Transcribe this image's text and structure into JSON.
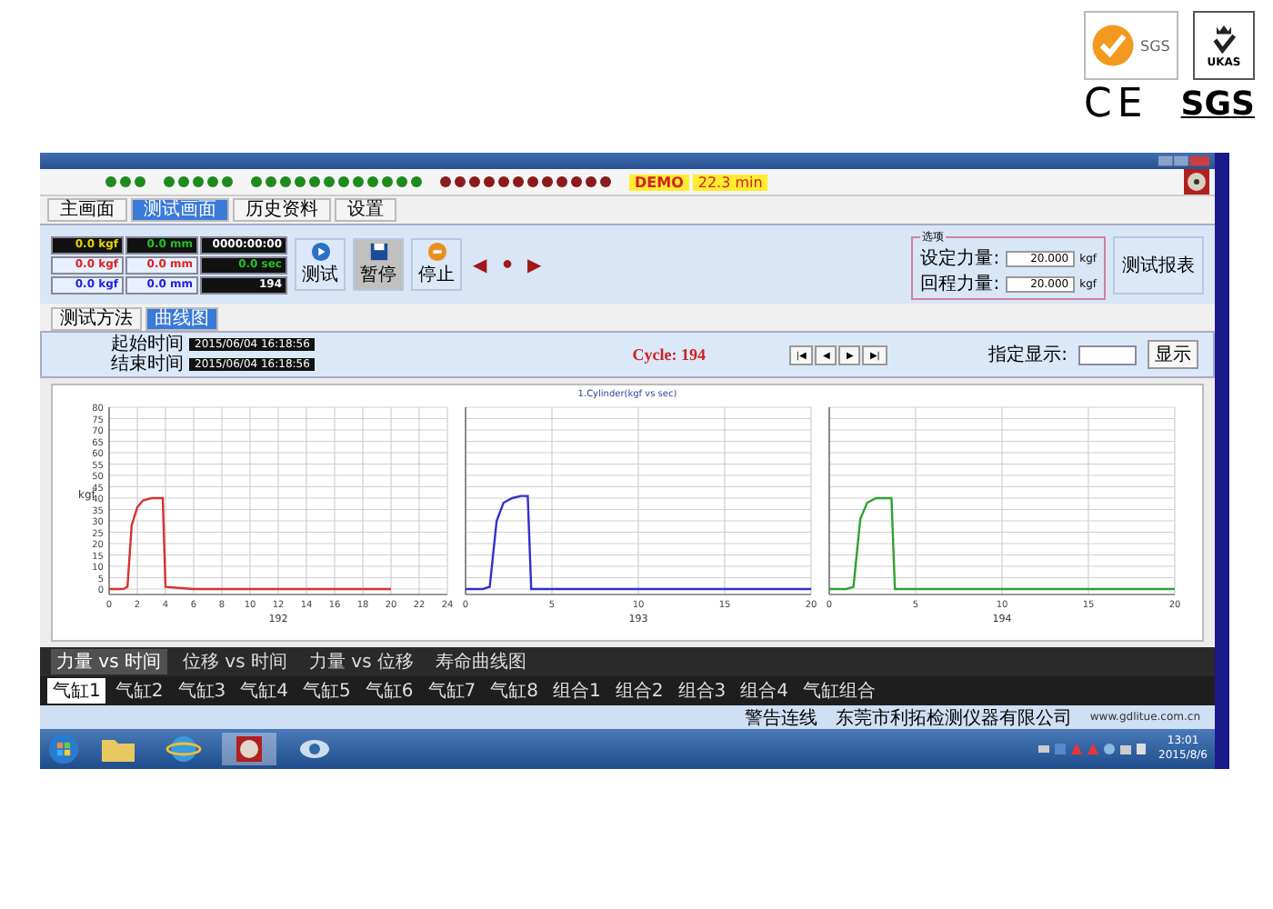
{
  "logos": {
    "badge_text": "SGS",
    "ukas_text": "UKAS",
    "ce_text": "CE",
    "sgs_text": "SGS"
  },
  "led_groups": [
    {
      "color": "#1e8a1e",
      "leds": [
        {
          "lit": true
        },
        {
          "lit": true
        },
        {
          "lit": true
        }
      ]
    },
    {
      "color": "#1e8a1e",
      "leds": [
        {
          "lit": true
        },
        {
          "lit": true
        },
        {
          "lit": true
        },
        {
          "lit": true
        },
        {
          "lit": true
        }
      ]
    },
    {
      "color": "#1e8a1e",
      "leds": [
        {
          "lit": true
        },
        {
          "lit": true
        },
        {
          "lit": true
        },
        {
          "lit": true
        },
        {
          "lit": true
        },
        {
          "lit": true
        },
        {
          "lit": true
        },
        {
          "lit": true
        },
        {
          "lit": true
        },
        {
          "lit": true
        },
        {
          "lit": true
        },
        {
          "lit": true
        }
      ]
    },
    {
      "color": "#8b1a1a",
      "leds": [
        {
          "lit": true
        },
        {
          "lit": true
        },
        {
          "lit": true
        },
        {
          "lit": true
        },
        {
          "lit": true
        },
        {
          "lit": true
        },
        {
          "lit": true
        },
        {
          "lit": true
        },
        {
          "lit": true
        },
        {
          "lit": true
        },
        {
          "lit": true
        },
        {
          "lit": true
        }
      ]
    }
  ],
  "demo": "DEMO",
  "elapsed": "22.3 min",
  "tabs": [
    {
      "label": "主画面",
      "selected": false
    },
    {
      "label": "测试画面",
      "selected": true
    },
    {
      "label": "历史资料",
      "selected": false
    },
    {
      "label": "设置",
      "selected": false
    }
  ],
  "readings": [
    [
      {
        "text": "0.0 kgf",
        "color": "#e8d200",
        "dark": true
      },
      {
        "text": "0.0 mm",
        "color": "#22c022",
        "dark": true
      },
      {
        "text": "0000:00:00",
        "color": "#ffffff",
        "dark": true
      }
    ],
    [
      {
        "text": "0.0 kgf",
        "color": "#e02020",
        "dark": false
      },
      {
        "text": "0.0 mm",
        "color": "#e02020",
        "dark": false
      },
      {
        "text": "0.0 sec",
        "color": "#22c022",
        "dark": true
      }
    ],
    [
      {
        "text": "0.0 kgf",
        "color": "#2020e0",
        "dark": false
      },
      {
        "text": "0.0 mm",
        "color": "#2020e0",
        "dark": false
      },
      {
        "text": "194",
        "color": "#ffffff",
        "dark": true
      }
    ]
  ],
  "actions": [
    {
      "kind": "start",
      "label": "测试",
      "pressed": false
    },
    {
      "kind": "save",
      "label": "暂停",
      "pressed": true
    },
    {
      "kind": "stop",
      "label": "停止",
      "pressed": false
    }
  ],
  "nav_glyphs": [
    "◀",
    "●",
    "▶"
  ],
  "settings": {
    "legend": "选项",
    "rows": [
      {
        "label": "设定力量:",
        "value": "20.000",
        "unit": "kgf"
      },
      {
        "label": "回程力量:",
        "value": "20.000",
        "unit": "kgf"
      }
    ]
  },
  "report_button": "测试报表",
  "subtabs": [
    {
      "label": "测试方法",
      "selected": false
    },
    {
      "label": "曲线图",
      "selected": true
    }
  ],
  "times": [
    {
      "label": "起始时间",
      "value": "2015/06/04 16:18:56"
    },
    {
      "label": "结束时间",
      "value": "2015/06/04 16:18:56"
    }
  ],
  "cycle": "Cycle: 194",
  "pager": [
    "|◀",
    "◀",
    "▶",
    "▶|"
  ],
  "goto": {
    "label": "指定显示:",
    "button": "显示"
  },
  "chart_title": "1.Cylinder(kgf vs sec)",
  "charts": [
    {
      "chart_data": {
        "type": "line",
        "grid": true,
        "ylabel": "kgf",
        "x": [
          0,
          1,
          1.3,
          1.6,
          2,
          2.4,
          3,
          3.6,
          3.8,
          4,
          6,
          10,
          14,
          18,
          20
        ],
        "series": [
          {
            "name": "192",
            "color": "#d83030",
            "values": [
              0,
              0,
              1,
              28,
              36,
              39,
              40,
              40,
              40,
              1,
              0,
              0,
              0,
              0,
              0
            ]
          }
        ],
        "xlim": [
          0,
          24
        ],
        "ylim": [
          0,
          80
        ],
        "xticks": [
          0,
          2,
          4,
          6,
          8,
          10,
          12,
          14,
          16,
          18,
          20,
          22,
          24
        ],
        "yticks": [
          0,
          5,
          10,
          15,
          20,
          25,
          30,
          35,
          40,
          45,
          50,
          55,
          60,
          65,
          70,
          75,
          80
        ]
      }
    },
    {
      "chart_data": {
        "type": "line",
        "grid": true,
        "x": [
          0,
          1,
          1.4,
          1.8,
          2.2,
          2.7,
          3.2,
          3.6,
          3.8,
          5,
          8,
          12,
          16,
          20
        ],
        "series": [
          {
            "name": "193",
            "color": "#3030d0",
            "values": [
              0,
              0,
              1,
              30,
              38,
              40,
              41,
              41,
              0,
              0,
              0,
              0,
              0,
              0
            ]
          }
        ],
        "xlim": [
          0,
          20
        ],
        "ylim": [
          0,
          80
        ],
        "xticks": [
          0,
          5,
          10,
          15,
          20
        ]
      }
    },
    {
      "chart_data": {
        "type": "line",
        "grid": true,
        "x": [
          0,
          1,
          1.4,
          1.8,
          2.2,
          2.7,
          3.2,
          3.6,
          3.8,
          5,
          8,
          12,
          16,
          20
        ],
        "series": [
          {
            "name": "194",
            "color": "#30a030",
            "values": [
              0,
              0,
              1,
              31,
              38,
              40,
              40,
              40,
              0,
              0,
              0,
              0,
              0,
              0
            ]
          }
        ],
        "xlim": [
          0,
          20
        ],
        "ylim": [
          0,
          80
        ],
        "xticks": [
          0,
          5,
          10,
          15,
          20
        ]
      }
    }
  ],
  "legend_tabs": [
    {
      "label": "力量 vs 时间",
      "selected": true
    },
    {
      "label": "位移 vs 时间",
      "selected": false
    },
    {
      "label": "力量 vs 位移",
      "selected": false
    },
    {
      "label": "寿命曲线图",
      "selected": false
    }
  ],
  "bottom_tabs": [
    {
      "label": "气缸1",
      "selected": true
    },
    {
      "label": "气缸2",
      "selected": false
    },
    {
      "label": "气缸3",
      "selected": false
    },
    {
      "label": "气缸4",
      "selected": false
    },
    {
      "label": "气缸5",
      "selected": false
    },
    {
      "label": "气缸6",
      "selected": false
    },
    {
      "label": "气缸7",
      "selected": false
    },
    {
      "label": "气缸8",
      "selected": false
    },
    {
      "label": "组合1",
      "selected": false
    },
    {
      "label": "组合2",
      "selected": false
    },
    {
      "label": "组合3",
      "selected": false
    },
    {
      "label": "组合4",
      "selected": false
    },
    {
      "label": "气缸组合",
      "selected": false
    }
  ],
  "status": {
    "alert": "警告连线",
    "company": "东莞市利拓检测仪器有限公司",
    "url": "www.gdlitue.com.cn"
  },
  "taskbar": {
    "time": "13:01",
    "date": "2015/8/6"
  }
}
